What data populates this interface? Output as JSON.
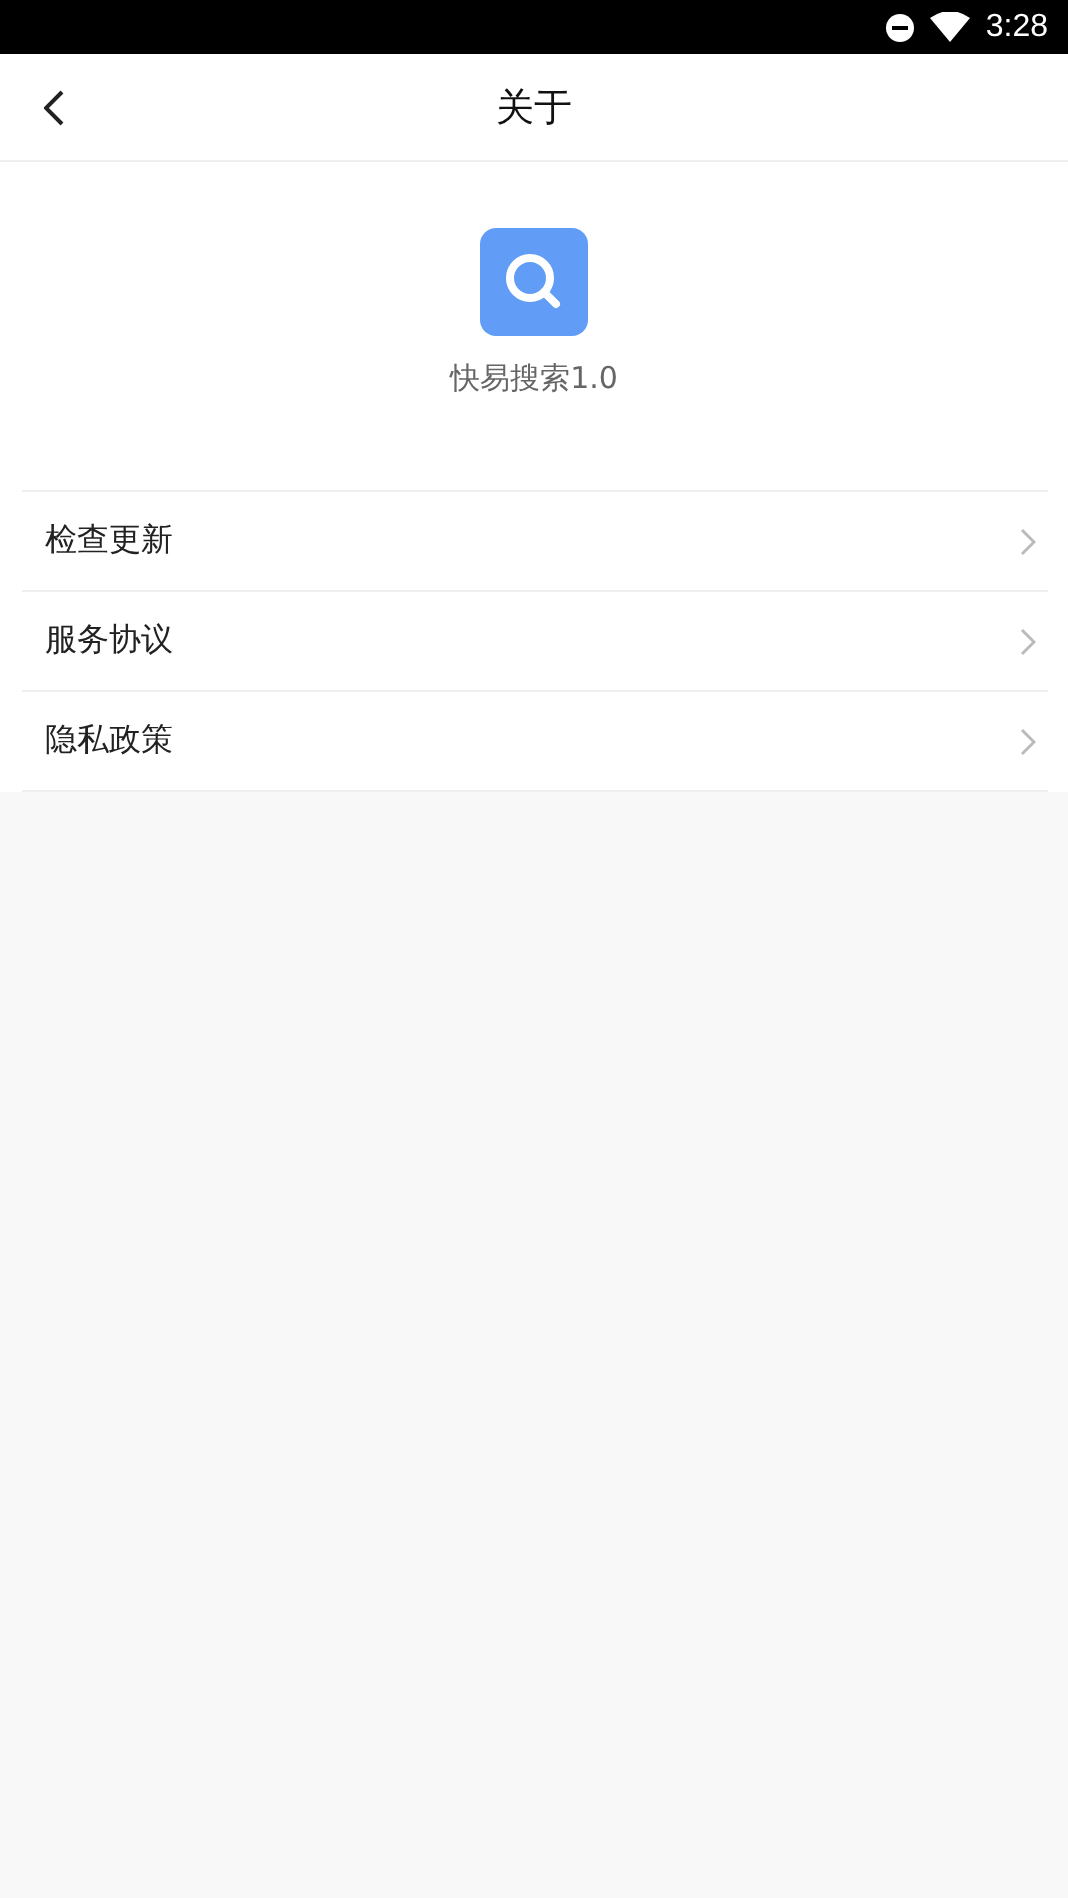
{
  "status_bar": {
    "time": "3:28"
  },
  "header": {
    "title": "关于"
  },
  "app": {
    "name": "快易搜索1.0"
  },
  "menu": [
    {
      "label": "检查更新"
    },
    {
      "label": "服务协议"
    },
    {
      "label": "隐私政策"
    }
  ]
}
